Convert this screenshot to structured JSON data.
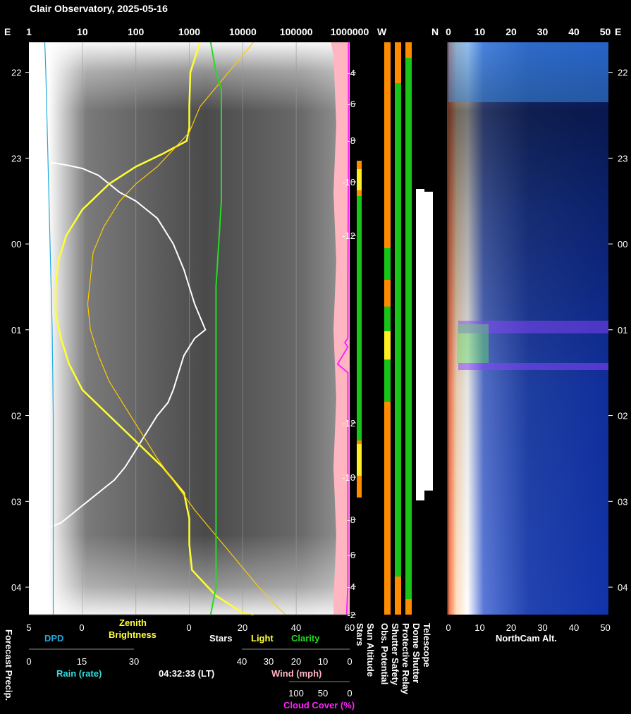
{
  "title": "Clair Observatory, 2025-05-16",
  "timestamp": "04:32:33 (LT)",
  "colors": {
    "bg": "#000000",
    "stars": "#ffffff",
    "light": "#ffff33",
    "clarity": "#22dd22",
    "dpd": "#22aadd",
    "rain": "#33dddd",
    "wind": "#ffb6c1",
    "cloud": "#ff22ff",
    "sun": "#ff8c00",
    "green": "#18c418",
    "orange": "#ff8c00",
    "yellow": "#ffee22",
    "camera": "#1133aa"
  },
  "chart_data": [
    {
      "type": "line",
      "panel": "left",
      "top_axis": {
        "edge_label": "E",
        "ticks": [
          "1",
          "10",
          "100",
          "1000",
          "10000",
          "100000",
          "1000000"
        ],
        "scale": "log"
      },
      "y_ticks": [
        "22",
        "23",
        "00",
        "01",
        "02",
        "03",
        "04"
      ],
      "series": [
        {
          "name": "Stars",
          "x_units": "0-60",
          "points": [
            [
              3,
              23.02
            ],
            [
              4,
              23.05
            ],
            [
              7,
              23.08
            ],
            [
              10,
              23.12
            ],
            [
              13,
              23.2
            ],
            [
              15,
              23.3
            ],
            [
              17,
              23.4
            ],
            [
              20,
              23.5
            ],
            [
              22,
              23.6
            ],
            [
              24,
              23.7
            ],
            [
              25,
              23.8
            ],
            [
              26,
              23.9
            ],
            [
              27,
              24.0
            ],
            [
              28,
              24.15
            ],
            [
              29,
              24.3
            ],
            [
              30,
              24.5
            ],
            [
              31,
              24.7
            ],
            [
              32,
              24.85
            ],
            [
              33,
              25.0
            ],
            [
              31,
              25.1
            ],
            [
              29,
              25.3
            ],
            [
              28,
              25.5
            ],
            [
              27,
              25.7
            ],
            [
              26,
              25.85
            ],
            [
              24,
              26.0
            ],
            [
              22,
              26.2
            ],
            [
              20,
              26.4
            ],
            [
              18,
              26.6
            ],
            [
              16,
              26.75
            ],
            [
              14,
              26.85
            ],
            [
              12,
              26.95
            ],
            [
              10,
              27.05
            ],
            [
              8,
              27.15
            ],
            [
              6,
              27.25
            ],
            [
              4,
              27.3
            ],
            [
              2,
              27.35
            ]
          ]
        },
        {
          "name": "Light",
          "x_units": "log10 brightness (0-6)",
          "points": [
            [
              3.2,
              21.65
            ],
            [
              3.02,
              22.0
            ],
            [
              3.0,
              22.4
            ],
            [
              3.0,
              22.65
            ],
            [
              2.95,
              22.8
            ],
            [
              2.5,
              22.95
            ],
            [
              2.0,
              23.1
            ],
            [
              1.5,
              23.3
            ],
            [
              1.0,
              23.6
            ],
            [
              0.7,
              23.9
            ],
            [
              0.55,
              24.2
            ],
            [
              0.5,
              24.5
            ],
            [
              0.5,
              24.8
            ],
            [
              0.6,
              25.1
            ],
            [
              0.75,
              25.4
            ],
            [
              1.0,
              25.7
            ],
            [
              1.5,
              26.0
            ],
            [
              2.0,
              26.3
            ],
            [
              2.5,
              26.6
            ],
            [
              2.9,
              26.9
            ],
            [
              3.0,
              27.2
            ],
            [
              3.0,
              27.5
            ],
            [
              3.05,
              27.8
            ],
            [
              3.5,
              28.1
            ],
            [
              4.0,
              28.3
            ],
            [
              4.2,
              28.32
            ]
          ]
        },
        {
          "name": "Zenith Brightness",
          "x_units": "log10 brightness (0-6)",
          "points": [
            [
              4.2,
              21.65
            ],
            [
              4.0,
              21.8
            ],
            [
              3.6,
              22.1
            ],
            [
              3.2,
              22.4
            ],
            [
              3.0,
              22.7
            ],
            [
              2.7,
              22.9
            ],
            [
              2.4,
              23.1
            ],
            [
              2.0,
              23.3
            ],
            [
              1.7,
              23.5
            ],
            [
              1.4,
              23.8
            ],
            [
              1.2,
              24.1
            ],
            [
              1.15,
              24.4
            ],
            [
              1.1,
              24.7
            ],
            [
              1.15,
              25.0
            ],
            [
              1.3,
              25.3
            ],
            [
              1.5,
              25.6
            ],
            [
              1.8,
              25.9
            ],
            [
              2.1,
              26.2
            ],
            [
              2.4,
              26.5
            ],
            [
              2.75,
              26.8
            ],
            [
              3.1,
              27.1
            ],
            [
              3.5,
              27.4
            ],
            [
              3.9,
              27.7
            ],
            [
              4.3,
              28.0
            ],
            [
              4.6,
              28.2
            ],
            [
              4.8,
              28.32
            ]
          ]
        },
        {
          "name": "Clarity",
          "x_units": "0-60",
          "points": [
            [
              34,
              21.65
            ],
            [
              35,
              22.0
            ],
            [
              36,
              22.2
            ],
            [
              36,
              22.5
            ],
            [
              36,
              23.0
            ],
            [
              36,
              23.5
            ],
            [
              35.5,
              24.0
            ],
            [
              35,
              24.5
            ],
            [
              35,
              25.0
            ],
            [
              35,
              25.5
            ],
            [
              35,
              26.0
            ],
            [
              35,
              26.5
            ],
            [
              35,
              27.0
            ],
            [
              35,
              27.5
            ],
            [
              35,
              28.0
            ],
            [
              34,
              28.32
            ]
          ]
        },
        {
          "name": "DPD",
          "x_units": "5 to 0",
          "points": [
            [
              3.5,
              21.65
            ],
            [
              3.4,
              22.0
            ],
            [
              3.3,
              22.5
            ],
            [
              3.2,
              23.0
            ],
            [
              3.1,
              23.5
            ],
            [
              3.0,
              24.0
            ],
            [
              2.9,
              24.5
            ],
            [
              2.8,
              25.0
            ],
            [
              2.75,
              25.5
            ],
            [
              2.7,
              26.0
            ],
            [
              2.7,
              26.5
            ],
            [
              2.7,
              27.0
            ],
            [
              2.7,
              27.5
            ],
            [
              2.7,
              28.0
            ],
            [
              2.7,
              28.32
            ]
          ]
        },
        {
          "name": "Wind",
          "x_units": "mph 40 to 0",
          "points": [
            [
              7,
              21.65
            ],
            [
              6,
              21.8
            ],
            [
              5.5,
              22.2
            ],
            [
              5,
              22.6
            ],
            [
              5.5,
              23.0
            ],
            [
              6,
              23.4
            ],
            [
              5.5,
              23.8
            ],
            [
              5,
              24.2
            ],
            [
              5.5,
              24.6
            ],
            [
              6,
              25.0
            ],
            [
              5.5,
              25.4
            ],
            [
              5,
              25.8
            ],
            [
              5.5,
              26.2
            ],
            [
              6,
              26.6
            ],
            [
              5.5,
              27.0
            ],
            [
              5,
              27.4
            ],
            [
              5.5,
              27.8
            ],
            [
              6,
              28.1
            ],
            [
              6,
              28.32
            ]
          ]
        },
        {
          "name": "Cloud Cover",
          "x_units": "% 100 to 0",
          "points": [
            [
              2,
              21.65
            ],
            [
              2,
              23.0
            ],
            [
              3,
              24.5
            ],
            [
              3,
              25.1
            ],
            [
              8,
              25.15
            ],
            [
              3,
              25.2
            ],
            [
              20,
              25.4
            ],
            [
              3,
              25.5
            ],
            [
              3,
              26.5
            ],
            [
              3,
              28.0
            ],
            [
              5,
              28.32
            ]
          ]
        }
      ]
    },
    {
      "type": "line",
      "panel": "sun-altitude",
      "name": "Sun Altitude",
      "left_labels": [
        "-4",
        "-6",
        "-8",
        "-10",
        "-12",
        "-12",
        "-10",
        "-8",
        "-6",
        "-4",
        "-2"
      ]
    },
    {
      "type": "heatmap",
      "panel": "status-bars",
      "top_labels": {
        "left": "W",
        "right": "N"
      },
      "columns": [
        "Obs. Potential",
        "Shutter Safety",
        "Protective Relay",
        "Dome Shutter",
        "Telescope"
      ]
    },
    {
      "type": "heatmap",
      "panel": "northcam",
      "name": "NorthCam Alt.",
      "ticks": [
        "0",
        "10",
        "20",
        "30",
        "40",
        "50"
      ],
      "edge_label": "E",
      "y_ticks": [
        "22",
        "23",
        "00",
        "01",
        "02",
        "03",
        "04"
      ]
    }
  ],
  "bottom_axes": {
    "forecast_precip": "Forecast Precip.",
    "dpd": {
      "label": "DPD",
      "ticks": [
        "5",
        "0"
      ]
    },
    "zenith": {
      "label": "Zenith\nBrightness",
      "ticks": [
        "0",
        "20",
        "40",
        "60"
      ]
    },
    "stars_label": "Stars",
    "light_label": "Light",
    "clarity_label": "Clarity",
    "rain": {
      "label": "Rain (rate)",
      "ticks": [
        "0",
        "15",
        "30"
      ]
    },
    "wind": {
      "label": "Wind (mph)",
      "ticks": [
        "40",
        "30",
        "20",
        "10",
        "0"
      ]
    },
    "cloud": {
      "label": "Cloud Cover (%)",
      "ticks": [
        "100",
        "50",
        "0"
      ]
    },
    "vertical_labels": [
      "Stars",
      "Sun Altitude"
    ]
  }
}
